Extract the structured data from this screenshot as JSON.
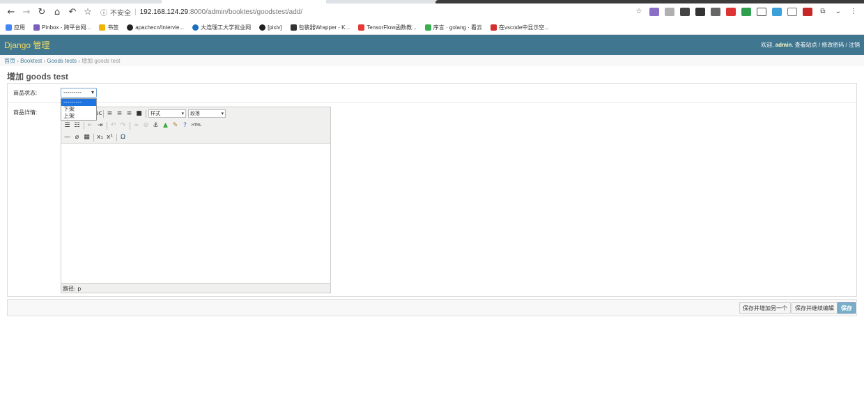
{
  "browser": {
    "security_label": "不安全",
    "url_host": "192.168.124.29",
    "url_path": ":8000/admin/booktest/goodstest/add/",
    "bookmarks": [
      {
        "label": "应用",
        "color": "#4285f4"
      },
      {
        "label": "Pinbox - 跨平台网...",
        "color": "#7b5fb8"
      },
      {
        "label": "书签",
        "color": "#f2b400"
      },
      {
        "label": "apachecn/Intervie...",
        "color": "#222222"
      },
      {
        "label": "大连理工大学就业网",
        "color": "#1a6fc2"
      },
      {
        "label": "[pixiv]",
        "color": "#222222"
      },
      {
        "label": "包装器Wrapper - K...",
        "color": "#333333"
      },
      {
        "label": "TensorFlow函数教...",
        "color": "#e53935"
      },
      {
        "label": "序言 · golang · 看云",
        "color": "#3cae52"
      },
      {
        "label": "在vscode中显示空...",
        "color": "#d32f2f"
      }
    ]
  },
  "header": {
    "brand": "Django 管理",
    "welcome": "欢迎,",
    "username": "admin",
    "view_site": "查看站点",
    "change_password": "修改密码",
    "logout": "注销"
  },
  "breadcrumbs": {
    "home": "首页",
    "app": "Booktest",
    "model": "Goods tests",
    "current": "增加 goods test"
  },
  "page_title": "增加 goods test",
  "form": {
    "status_label": "商品状态:",
    "status_value": "---------",
    "status_options": [
      "---------",
      "下架",
      "上架"
    ],
    "detail_label": "商品详情:",
    "editor": {
      "style_select": "样式",
      "format_select": "段落",
      "path_label": "路径: p",
      "html_label": "HTML"
    }
  },
  "buttons": {
    "save_add_another": "保存并增加另一个",
    "save_continue": "保存并继续编辑",
    "save": "保存"
  }
}
